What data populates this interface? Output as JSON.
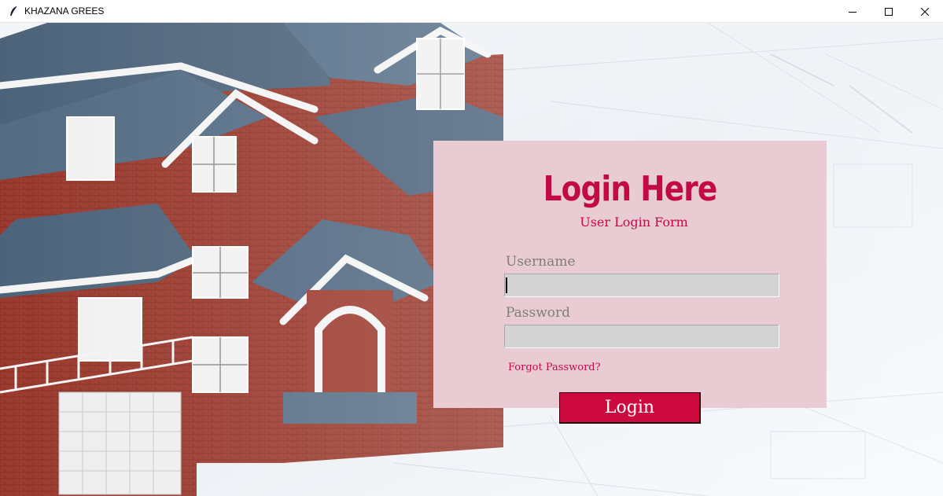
{
  "window": {
    "title": "KHAZANA GREES",
    "controls": [
      "minimize-icon",
      "maximize-icon",
      "close-icon"
    ]
  },
  "login": {
    "heading": "Login Here",
    "subheading": "User Login Form",
    "username_label": "Username",
    "username_value": "",
    "password_label": "Password",
    "password_value": "",
    "forgot_label": "Forgot Password?",
    "button_label": "Login"
  },
  "colors": {
    "accent": "#c20a44",
    "panel_bg": "#e9cbd4",
    "button_bg": "#cc0a40",
    "input_bg": "#d3d3d3"
  }
}
